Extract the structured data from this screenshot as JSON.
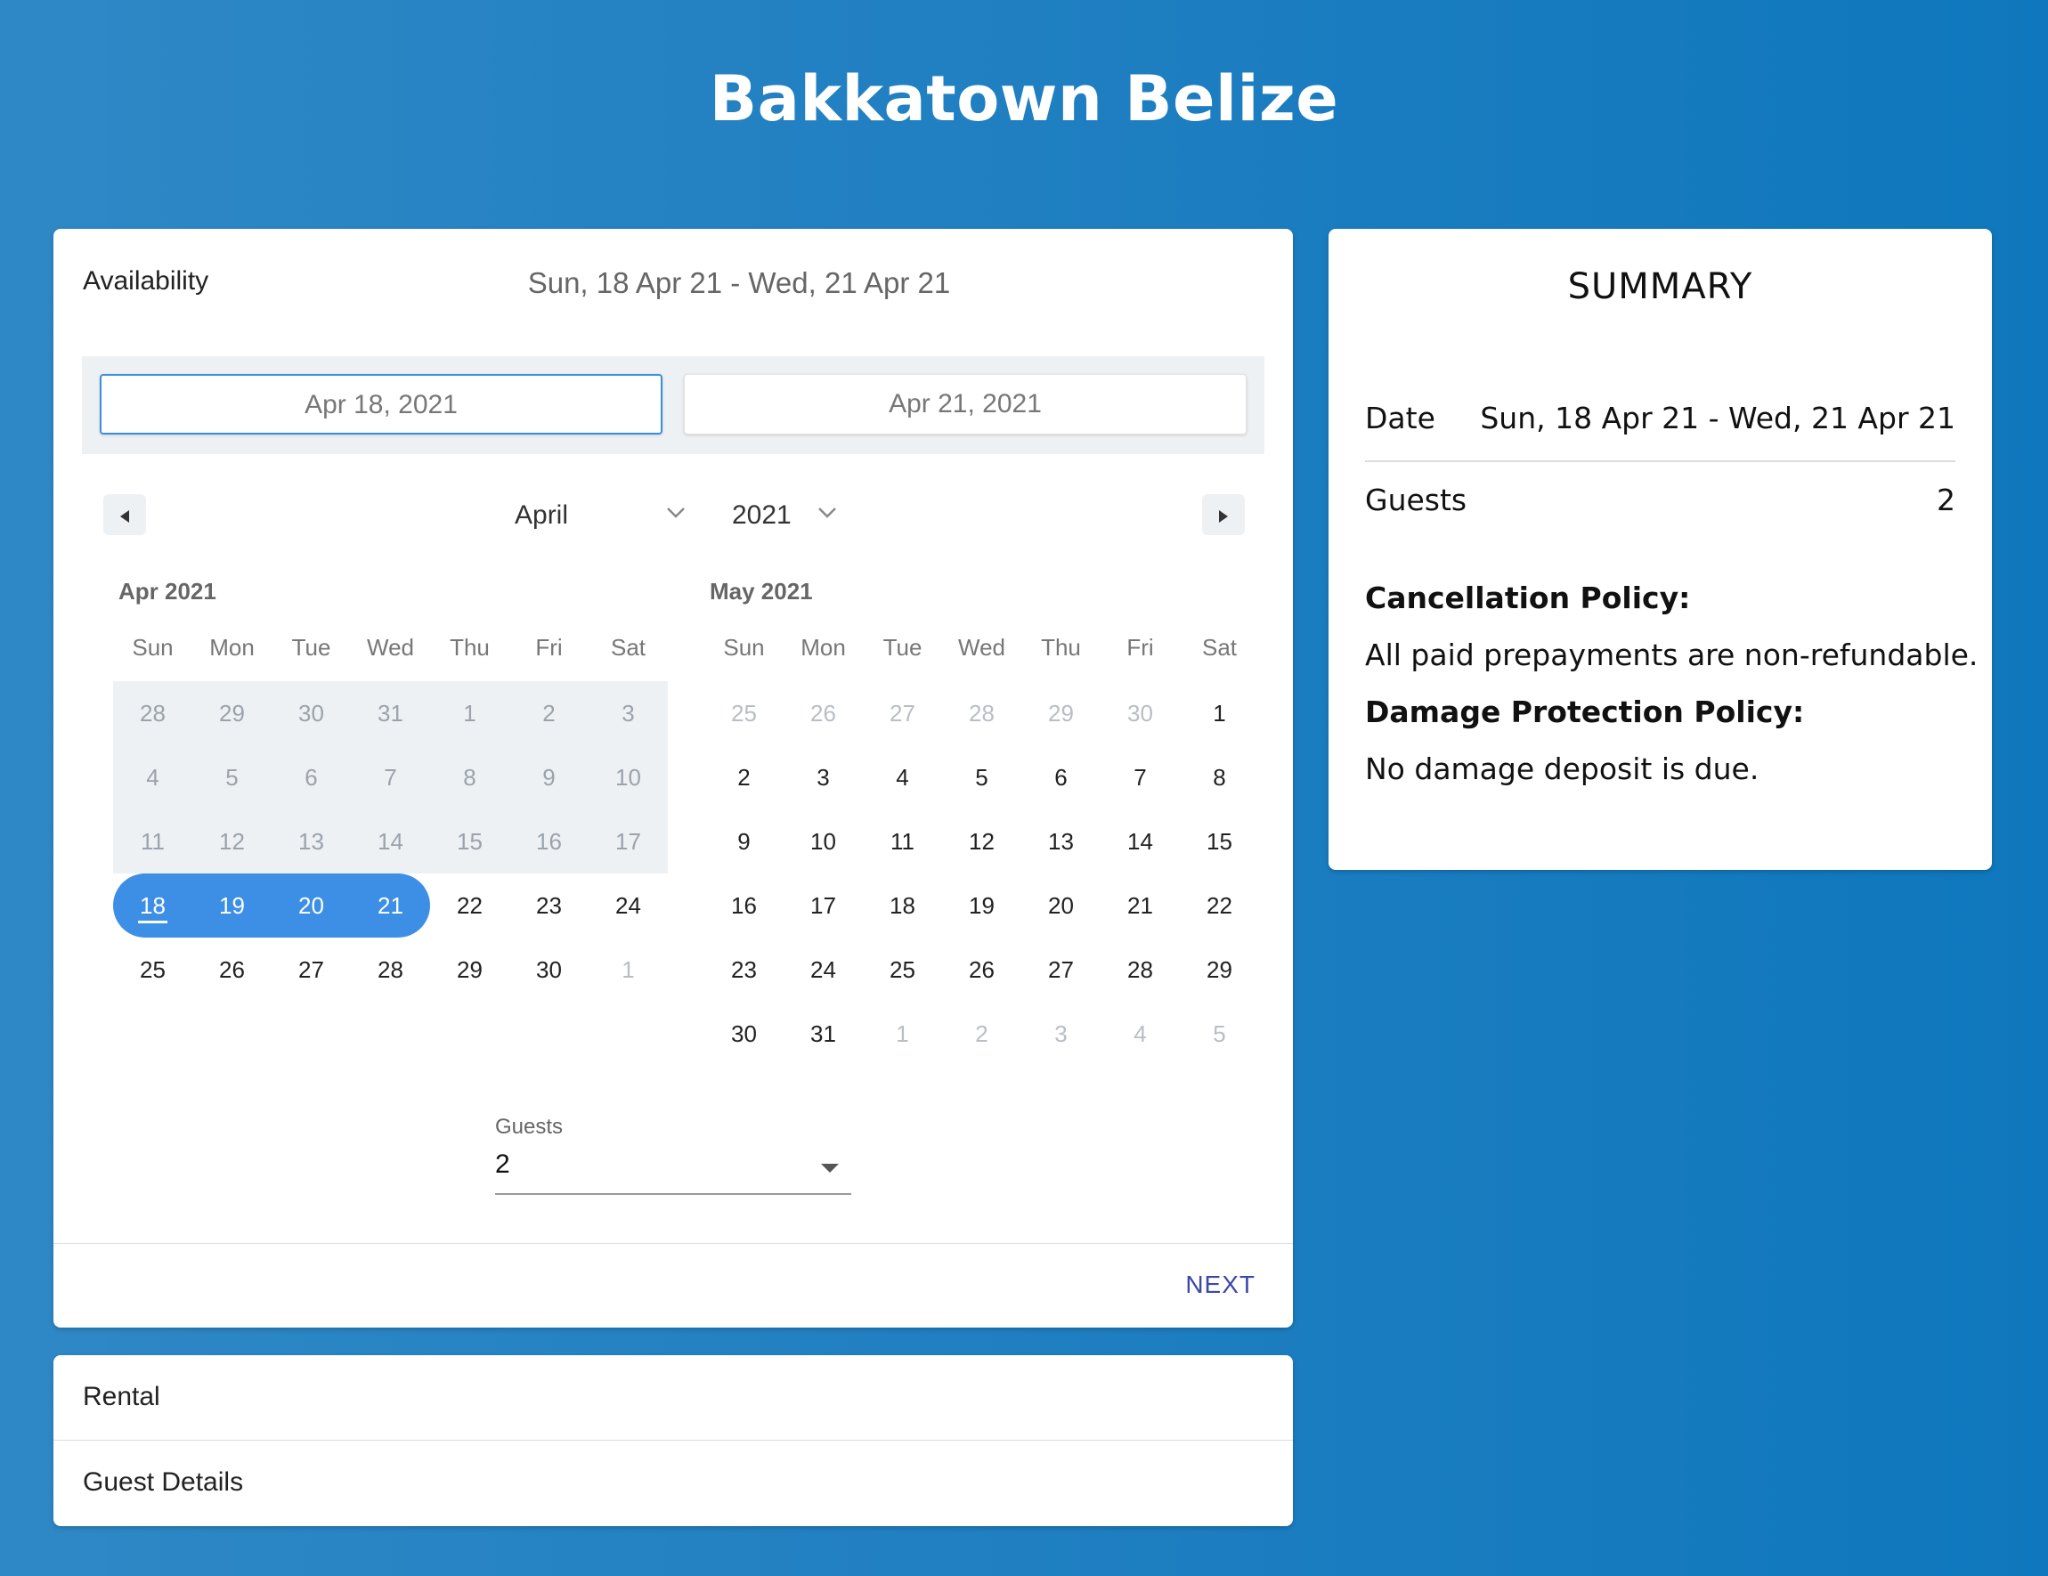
{
  "site": {
    "title": "Bakkatown Belize"
  },
  "booking": {
    "availability_label": "Availability",
    "range_text": "Sun, 18 Apr 21 - Wed, 21 Apr 21",
    "start_date": "Apr 18, 2021",
    "end_date": "Apr 21, 2021",
    "month_select": "April",
    "year_select": "2021",
    "prev_icon": "triangle-left-icon",
    "next_icon": "triangle-right-icon",
    "weekdays": [
      "Sun",
      "Mon",
      "Tue",
      "Wed",
      "Thu",
      "Fri",
      "Sat"
    ],
    "calendars": [
      {
        "title": "Apr 2021",
        "weeks": [
          [
            "28",
            "29",
            "30",
            "31",
            "1",
            "2",
            "3"
          ],
          [
            "4",
            "5",
            "6",
            "7",
            "8",
            "9",
            "10"
          ],
          [
            "11",
            "12",
            "13",
            "14",
            "15",
            "16",
            "17"
          ],
          [
            "18",
            "19",
            "20",
            "21",
            "22",
            "23",
            "24"
          ],
          [
            "25",
            "26",
            "27",
            "28",
            "29",
            "30",
            "1"
          ]
        ]
      },
      {
        "title": "May 2021",
        "weeks": [
          [
            "25",
            "26",
            "27",
            "28",
            "29",
            "30",
            "1"
          ],
          [
            "2",
            "3",
            "4",
            "5",
            "6",
            "7",
            "8"
          ],
          [
            "9",
            "10",
            "11",
            "12",
            "13",
            "14",
            "15"
          ],
          [
            "16",
            "17",
            "18",
            "19",
            "20",
            "21",
            "22"
          ],
          [
            "23",
            "24",
            "25",
            "26",
            "27",
            "28",
            "29"
          ],
          [
            "30",
            "31",
            "1",
            "2",
            "3",
            "4",
            "5"
          ]
        ]
      }
    ],
    "guests_label": "Guests",
    "guests_value": "2",
    "next_label": "NEXT"
  },
  "summary": {
    "title": "SUMMARY",
    "date_label": "Date",
    "date_value": "Sun, 18 Apr 21 - Wed, 21 Apr 21",
    "guests_label": "Guests",
    "guests_value": "2",
    "cancellation_heading": "Cancellation Policy:",
    "cancellation_text": "All paid prepayments are non-refundable.",
    "damage_heading": "Damage Protection Policy:",
    "damage_text": "No damage deposit is due."
  },
  "steps": {
    "rental": "Rental",
    "guest_details": "Guest Details"
  },
  "colors": {
    "accent": "#3d8fe6",
    "next_button": "#3a49a8",
    "background": "#1f7fc1"
  }
}
